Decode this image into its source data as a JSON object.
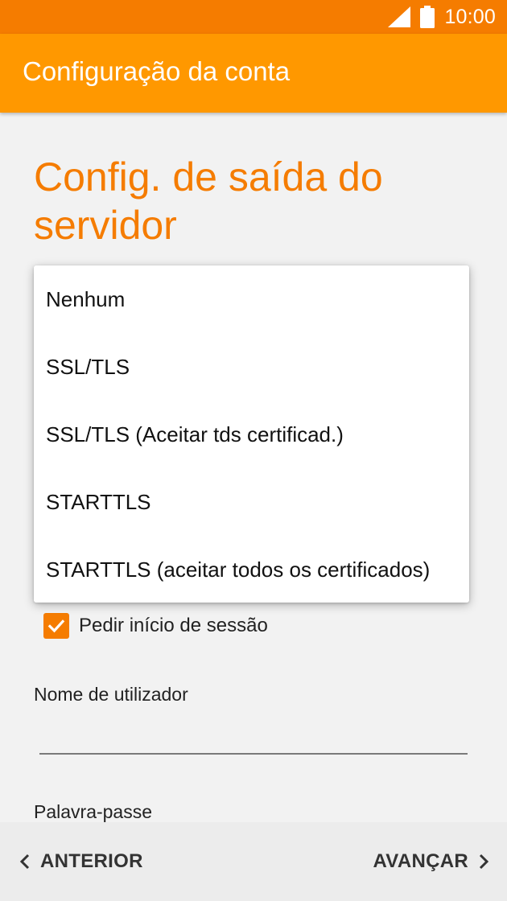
{
  "status_bar": {
    "time": "10:00",
    "icons": [
      "signal-icon",
      "battery-icon"
    ]
  },
  "app_bar": {
    "title": "Configuração da conta"
  },
  "page": {
    "heading": "Config. de saída do servidor"
  },
  "security_dropdown": {
    "options": [
      "Nenhum",
      "SSL/TLS",
      "SSL/TLS (Aceitar tds certificad.)",
      "STARTTLS",
      "STARTTLS (aceitar todos os certificados)"
    ]
  },
  "require_signin": {
    "label": "Pedir início de sessão",
    "checked": true
  },
  "username": {
    "label": "Nome de utilizador",
    "value": ""
  },
  "password": {
    "label": "Palavra-passe"
  },
  "navigation": {
    "prev_label": "ANTERIOR",
    "next_label": "AVANÇAR"
  },
  "colors": {
    "status_bar": "#f57c00",
    "app_bar": "#ff9800",
    "accent": "#f57c00",
    "background": "#f2f2f2"
  }
}
